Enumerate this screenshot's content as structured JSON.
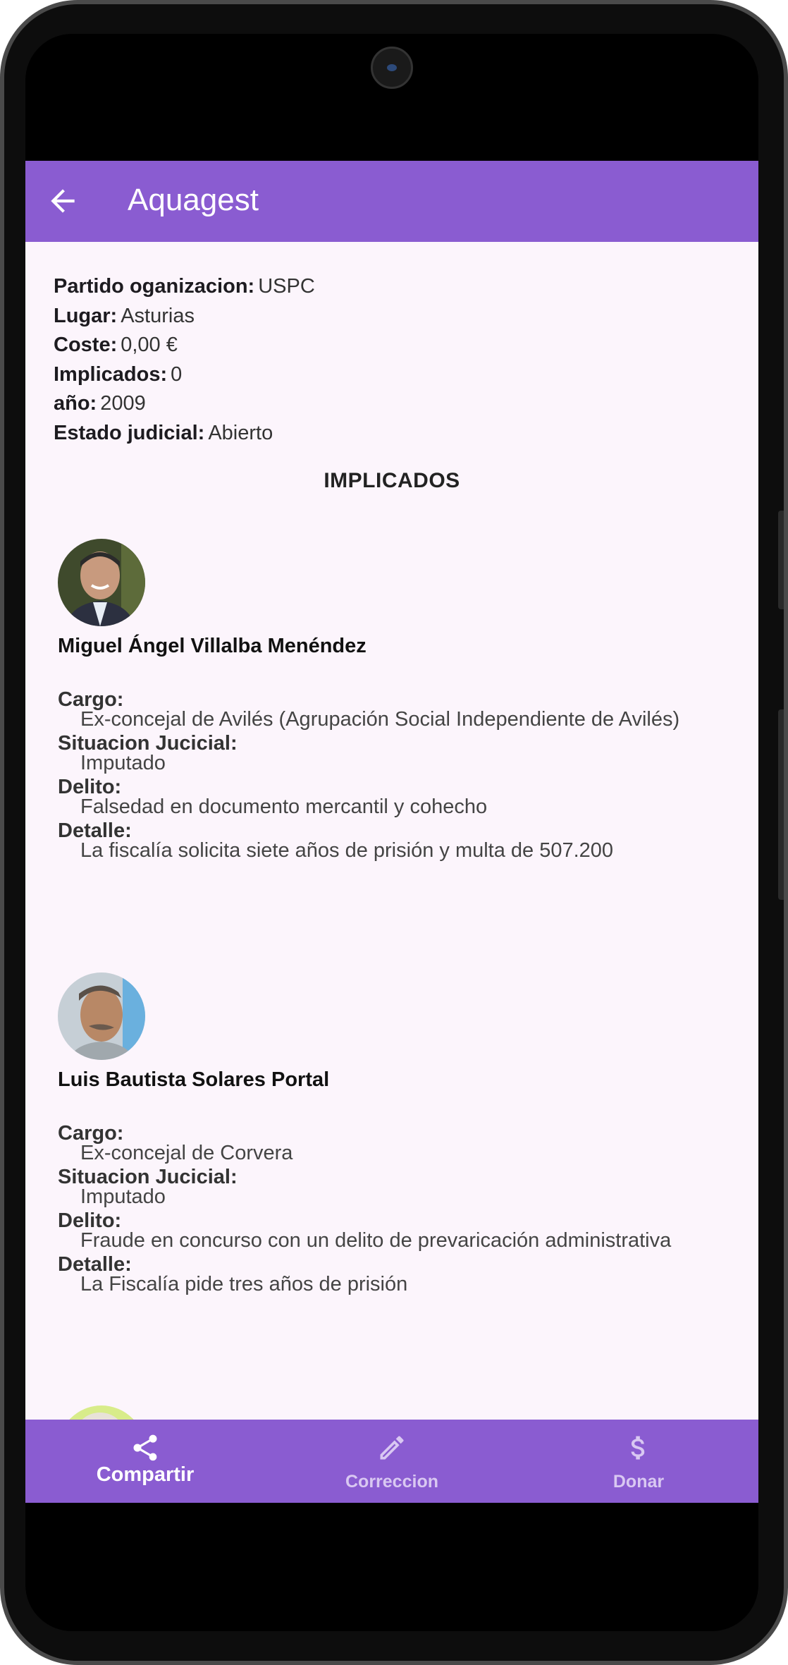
{
  "app": {
    "title": "Aquagest"
  },
  "details": [
    {
      "label": "Partido oganizacion:",
      "value": "USPC"
    },
    {
      "label": "Lugar:",
      "value": "Asturias"
    },
    {
      "label": "Coste:",
      "value": "0,00 €"
    },
    {
      "label": "Implicados:",
      "value": "0"
    },
    {
      "label": "año:",
      "value": "2009"
    },
    {
      "label": "Estado judicial:",
      "value": "Abierto"
    }
  ],
  "section_title": "IMPLICADOS",
  "people": [
    {
      "name": "Miguel Ángel Villalba Menéndez",
      "cargo_label": "Cargo:",
      "cargo": "Ex-concejal de Avilés (Agrupación Social Independiente de Avilés)",
      "situacion_label": "Situacion Jucicial:",
      "situacion": "Imputado",
      "delito_label": "Delito:",
      "delito": "Falsedad en documento mercantil y cohecho",
      "detalle_label": "Detalle:",
      "detalle": "La fiscalía solicita siete años de prisión y multa de 507.200"
    },
    {
      "name": "Luis Bautista Solares Portal",
      "cargo_label": "Cargo:",
      "cargo": "Ex-concejal de Corvera",
      "situacion_label": "Situacion Jucicial:",
      "situacion": "Imputado",
      "delito_label": "Delito:",
      "delito": "Fraude en concurso con un delito de prevaricación administrativa",
      "detalle_label": "Detalle:",
      "detalle": "La Fiscalía pide tres años de prisión"
    }
  ],
  "bottom_nav": [
    {
      "label": "Compartir",
      "icon": "share-icon",
      "active": true
    },
    {
      "label": "Correccion",
      "icon": "pencil-icon",
      "active": false
    },
    {
      "label": "Donar",
      "icon": "dollar-icon",
      "active": false
    }
  ],
  "colors": {
    "primary": "#8a5cd1",
    "background": "#fcf5fc"
  }
}
